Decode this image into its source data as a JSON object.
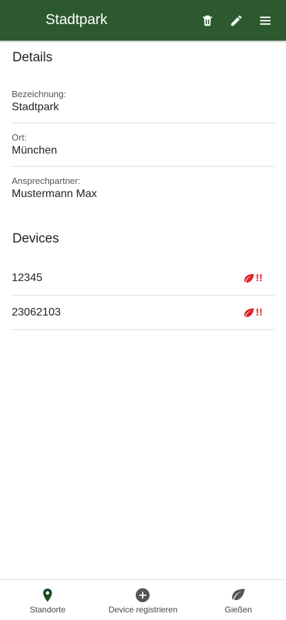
{
  "header": {
    "title": "Stadtpark",
    "actions": [
      {
        "icon": "trash-icon"
      },
      {
        "icon": "pencil-icon"
      },
      {
        "icon": "menu-icon"
      }
    ],
    "background": "#2c5a2e"
  },
  "details": {
    "title": "Details",
    "fields": [
      {
        "label": "Bezeichnung:",
        "value": "Stadtpark"
      },
      {
        "label": "Ort:",
        "value": "München"
      },
      {
        "label": "Ansprechpartner:",
        "value": "Mustermann Max"
      }
    ]
  },
  "devices": {
    "title": "Devices",
    "items": [
      {
        "id": "12345",
        "status_icon": "leaf-alert-icon",
        "status_text": "!!",
        "status_color": "#e0202a"
      },
      {
        "id": "23062103",
        "status_icon": "leaf-alert-icon",
        "status_text": "!!",
        "status_color": "#e0202a"
      }
    ]
  },
  "bottom_nav": {
    "items": [
      {
        "label": "Standorte",
        "icon": "map-pin-icon",
        "active": true
      },
      {
        "label": "Device registrieren",
        "icon": "add-circle-icon",
        "active": false
      },
      {
        "label": "Gießen",
        "icon": "leaf-icon",
        "active": false
      }
    ],
    "active_color": "#1f4a24",
    "inactive_color": "#555555"
  }
}
